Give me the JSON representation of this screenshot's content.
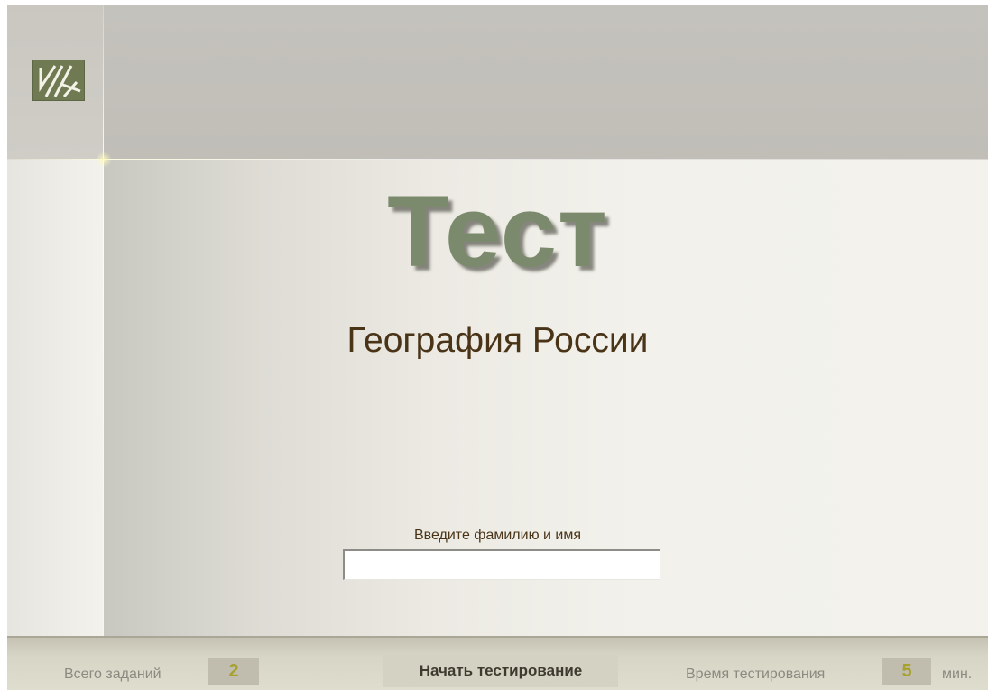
{
  "header": {
    "logo_icon": "abstract-lines-logo-icon"
  },
  "main": {
    "title": "Тест",
    "subtitle": "География России",
    "name_prompt": "Введите фамилию и имя",
    "name_value": ""
  },
  "footer": {
    "tasks_label": "Всего заданий",
    "tasks_count": "2",
    "start_button": "Начать тестирование",
    "time_label": "Время тестирования",
    "time_value": "5",
    "time_unit": "мин."
  },
  "colors": {
    "title": "#7b8a6c",
    "subtitle": "#4a3418",
    "accent_badge": "#a7a12f",
    "logo": "#6f7a52"
  }
}
